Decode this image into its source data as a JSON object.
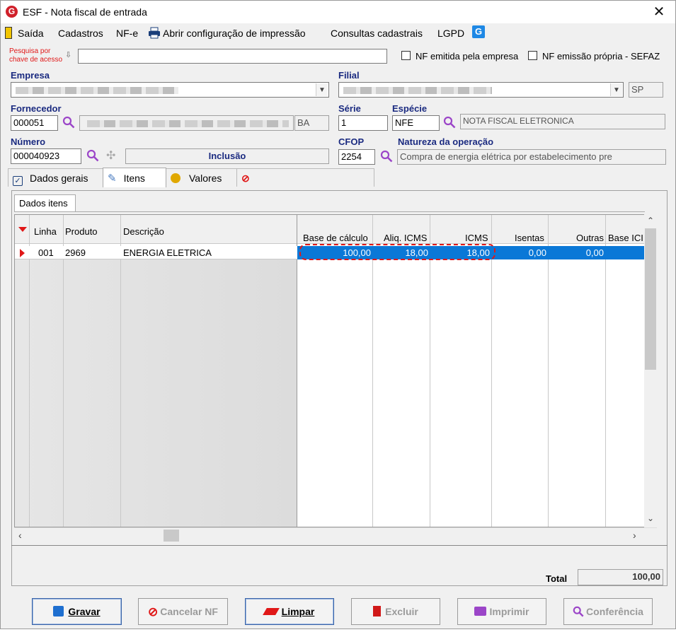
{
  "window": {
    "title": "ESF - Nota fiscal de entrada",
    "close": "✕"
  },
  "menu": {
    "items": [
      "Saída",
      "Cadastros",
      "NF-e",
      "Abrir configuração de impressão",
      "Consultas cadastrais",
      "LGPD"
    ]
  },
  "search": {
    "label_line1": "Pesquisa por",
    "label_line2": "chave de acesso",
    "value": "",
    "chk_emitida": "NF emitida pela empresa",
    "chk_propria": "NF emissão própria - SEFAZ"
  },
  "empresa": {
    "label": "Empresa",
    "value": ""
  },
  "filial": {
    "label": "Filial",
    "value": "",
    "uf": "SP"
  },
  "fornecedor": {
    "label": "Fornecedor",
    "code": "000051",
    "name": "",
    "uf": "BA"
  },
  "serie": {
    "label": "Série",
    "value": "1"
  },
  "especie": {
    "label": "Espécie",
    "code": "NFE",
    "desc": "NOTA FISCAL ELETRONICA"
  },
  "numero": {
    "label": "Número",
    "value": "000040923",
    "status": "Inclusão"
  },
  "cfop": {
    "label": "CFOP",
    "value": "2254"
  },
  "natureza": {
    "label": "Natureza da operação",
    "value": "Compra de energia elétrica por estabelecimento pre"
  },
  "tabs": [
    "Dados gerais",
    "Itens",
    "Valores"
  ],
  "subtab": "Dados itens",
  "grid": {
    "headers": {
      "linha": "Linha",
      "produto": "Produto",
      "descricao": "Descrição",
      "base": "Base de cálculo",
      "aliq": "Aliq. ICMS",
      "icms": "ICMS",
      "isentas": "Isentas",
      "outras": "Outras",
      "baseicms": "Base ICI"
    },
    "row": {
      "linha": "001",
      "produto": "2969",
      "descricao": "ENERGIA ELETRICA",
      "base": "100,00",
      "aliq": "18,00",
      "icms": "18,00",
      "isentas": "0,00",
      "outras": "0,00"
    }
  },
  "total": {
    "label": "Total",
    "value": "100,00"
  },
  "buttons": {
    "gravar": "Gravar",
    "cancelar": "Cancelar NF",
    "limpar": "Limpar",
    "excluir": "Excluir",
    "imprimir": "Imprimir",
    "conferencia": "Conferência"
  },
  "colors": {
    "label_blue": "#1a2a80",
    "selection": "#0a78d7",
    "highlight_red": "#e01818",
    "search_red": "#e01818"
  }
}
